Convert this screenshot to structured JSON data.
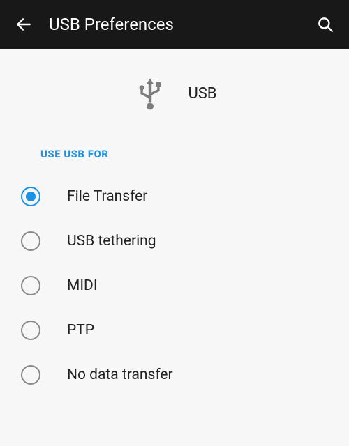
{
  "header": {
    "title": "USB Preferences"
  },
  "hero": {
    "label": "USB"
  },
  "section": {
    "heading": "USE USB FOR"
  },
  "options": [
    {
      "label": "File Transfer",
      "selected": true
    },
    {
      "label": "USB tethering",
      "selected": false
    },
    {
      "label": "MIDI",
      "selected": false
    },
    {
      "label": "PTP",
      "selected": false
    },
    {
      "label": "No data transfer",
      "selected": false
    }
  ],
  "colors": {
    "accent": "#1a93e6",
    "header_bg": "#181818"
  }
}
